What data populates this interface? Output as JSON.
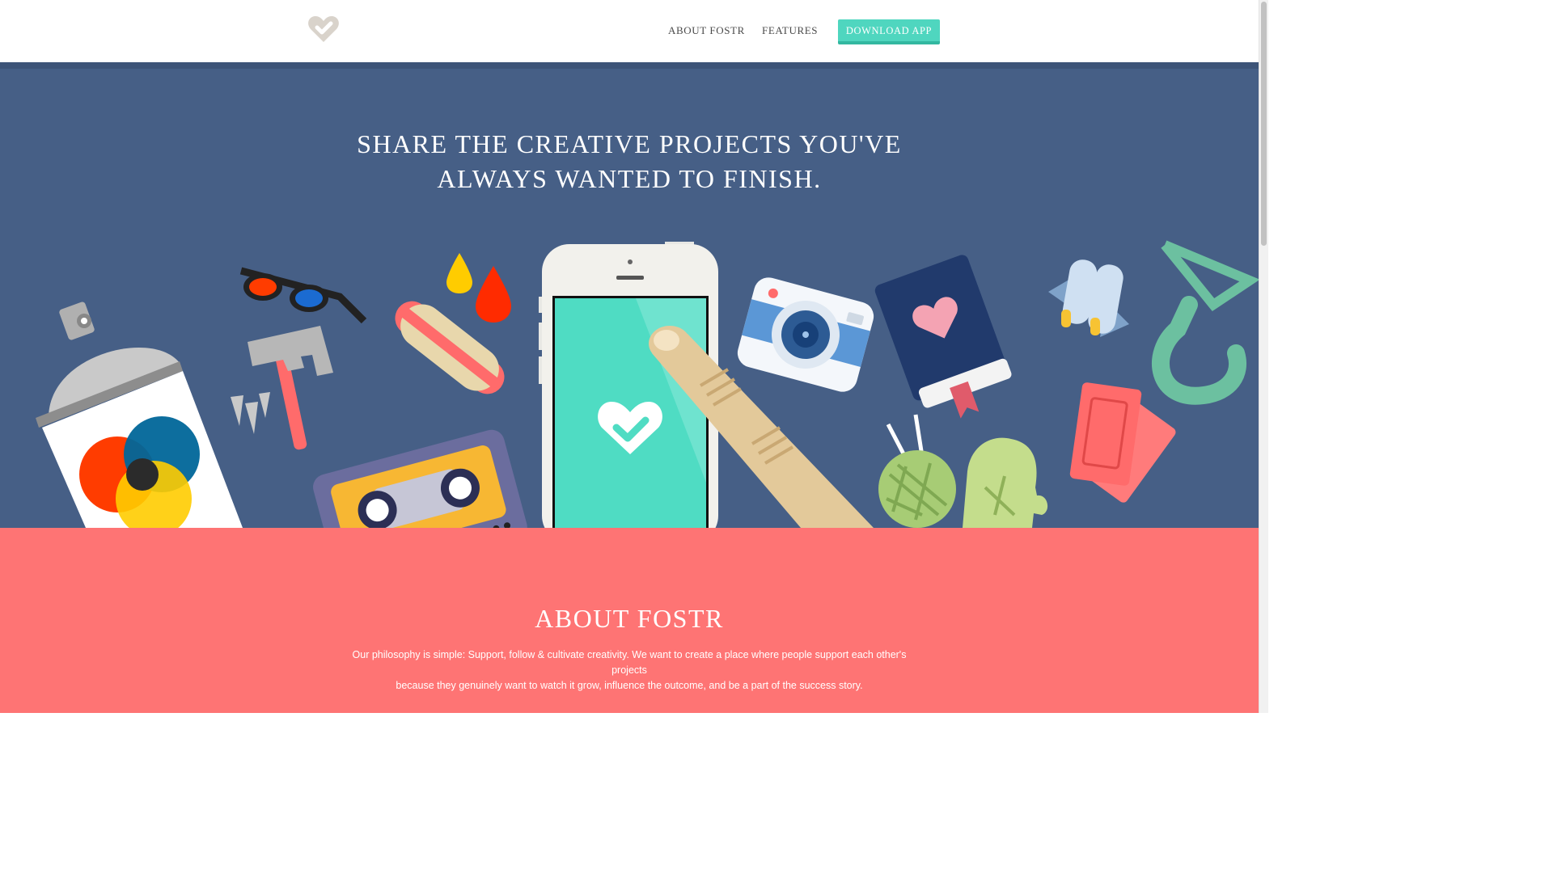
{
  "header": {
    "logo_icon": "heart-check-icon",
    "nav": {
      "about_label": "ABOUT FOSTR",
      "features_label": "FEATURES",
      "download_label": "DOWNLOAD APP"
    }
  },
  "hero": {
    "title_line1": "SHARE THE CREATIVE PROJECTS YOU'VE",
    "title_line2": "ALWAYS WANTED TO FINISH.",
    "illustration_icons": [
      "spray-can-icon",
      "3d-glasses-icon",
      "hammer-icon",
      "nails-icon",
      "hot-dog-icon",
      "paint-drops-icon",
      "cassette-tape-icon",
      "smartphone-icon",
      "finger-icon",
      "camera-icon",
      "book-icon",
      "popsicles-icon",
      "crane-hook-icon",
      "yarn-ball-icon",
      "mitten-icon",
      "tickets-icon"
    ]
  },
  "about": {
    "title": "ABOUT FOSTR",
    "line1": "Our philosophy is simple: Support, follow & cultivate creativity. We want to create a place where people support each other's projects",
    "line2": "because they genuinely want to watch it grow, influence the outcome, and be a part of the success story."
  },
  "colors": {
    "hero_bg": "#465f86",
    "about_bg": "#fe7474",
    "accent": "#4fd6bf"
  }
}
